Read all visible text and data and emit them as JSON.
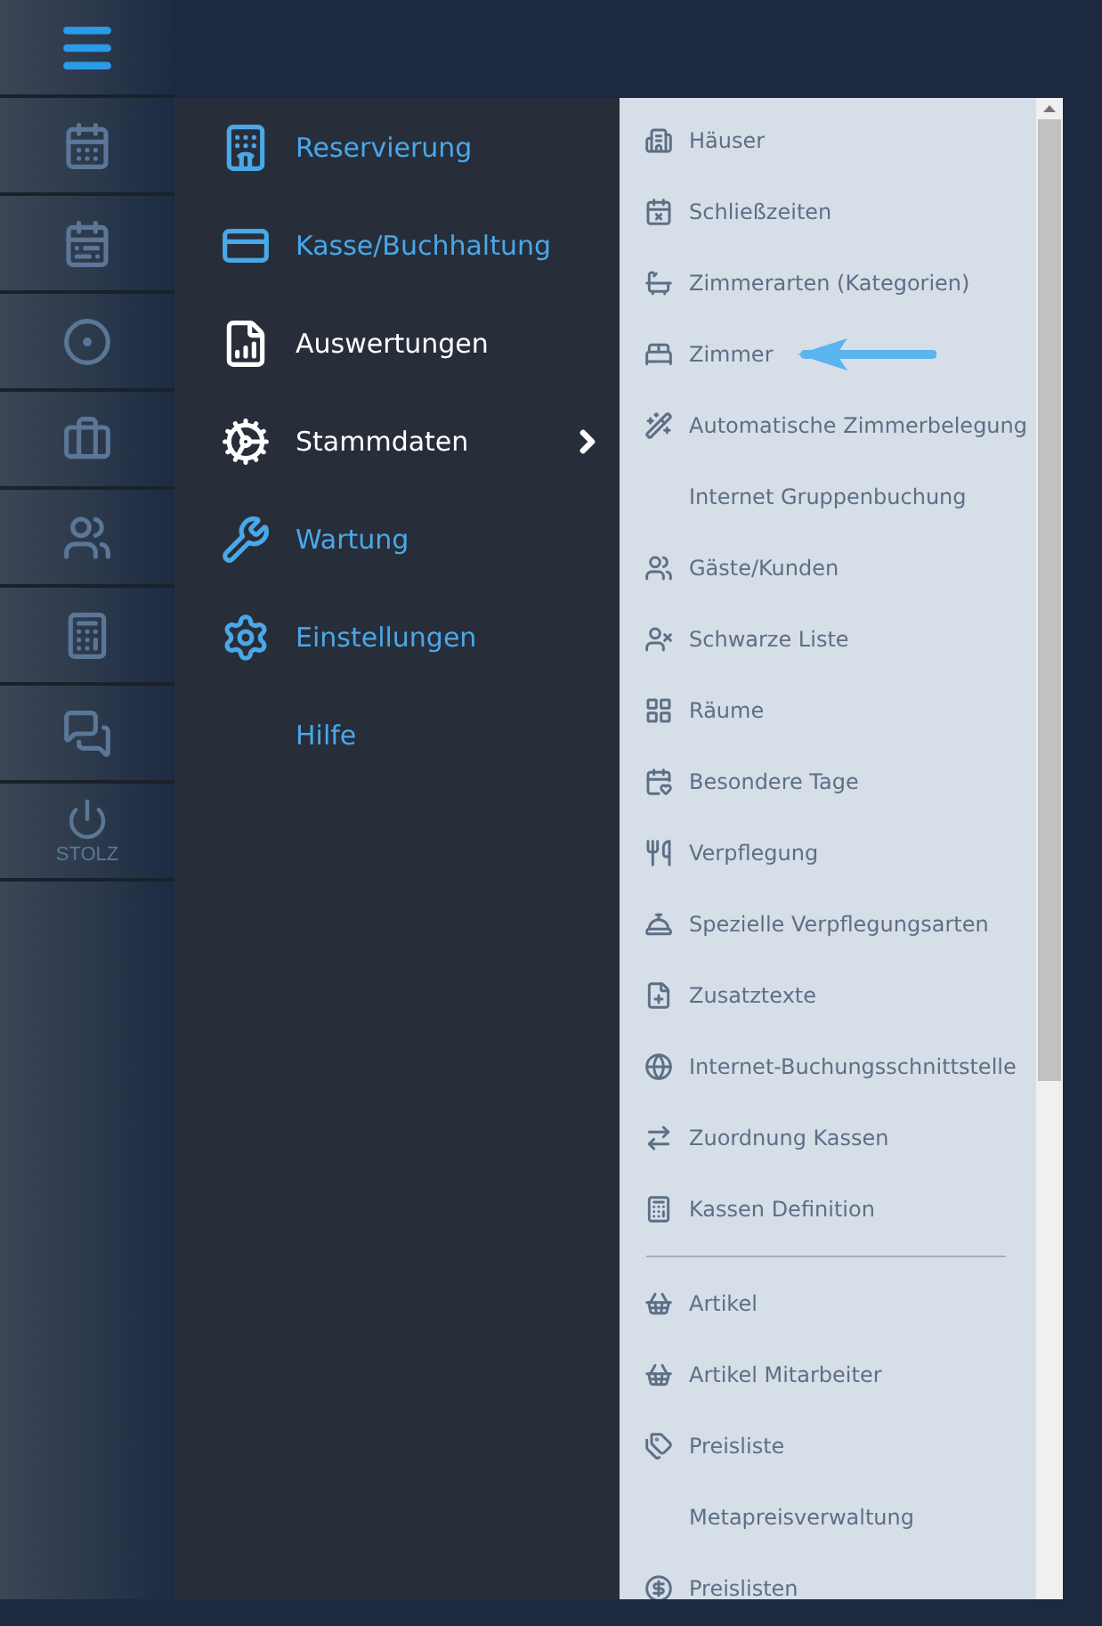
{
  "rail": {
    "items": [
      {
        "kind": "icon"
      },
      {
        "kind": "icon"
      },
      {
        "kind": "icon"
      },
      {
        "kind": "icon"
      },
      {
        "kind": "icon"
      },
      {
        "kind": "icon"
      },
      {
        "kind": "icon"
      },
      {
        "kind": "labeled",
        "label": "STOLZ"
      }
    ]
  },
  "menu": {
    "items": [
      {
        "label": "Reservierung",
        "highlighted": false,
        "expanded": false
      },
      {
        "label": "Kasse/Buchhaltung",
        "highlighted": false,
        "expanded": false
      },
      {
        "label": "Auswertungen",
        "highlighted": true,
        "expanded": false
      },
      {
        "label": "Stammdaten",
        "highlighted": true,
        "expanded": true
      },
      {
        "label": "Wartung",
        "highlighted": false,
        "expanded": false
      },
      {
        "label": "Einstellungen",
        "highlighted": false,
        "expanded": false
      },
      {
        "label": "Hilfe",
        "highlighted": false,
        "expanded": false
      }
    ]
  },
  "submenu": {
    "items": [
      {
        "kind": "link",
        "label": "Häuser"
      },
      {
        "kind": "link",
        "label": "Schließzeiten"
      },
      {
        "kind": "link",
        "label": "Zimmerarten (Kategorien)"
      },
      {
        "kind": "link",
        "label": "Zimmer"
      },
      {
        "kind": "link",
        "label": "Automatische Zimmerbelegung"
      },
      {
        "kind": "link",
        "label": "Internet Gruppenbuchung"
      },
      {
        "kind": "link",
        "label": "Gäste/Kunden"
      },
      {
        "kind": "link",
        "label": "Schwarze Liste"
      },
      {
        "kind": "link",
        "label": "Räume"
      },
      {
        "kind": "link",
        "label": "Besondere Tage"
      },
      {
        "kind": "link",
        "label": "Verpflegung"
      },
      {
        "kind": "link",
        "label": "Spezielle Verpflegungsarten"
      },
      {
        "kind": "link",
        "label": "Zusatztexte"
      },
      {
        "kind": "link",
        "label": "Internet-Buchungsschnittstelle"
      },
      {
        "kind": "link",
        "label": "Zuordnung Kassen"
      },
      {
        "kind": "link",
        "label": "Kassen Definition"
      },
      {
        "kind": "divider"
      },
      {
        "kind": "link",
        "label": "Artikel"
      },
      {
        "kind": "link",
        "label": "Artikel Mitarbeiter"
      },
      {
        "kind": "link",
        "label": "Preisliste"
      },
      {
        "kind": "link",
        "label": "Metapreisverwaltung"
      },
      {
        "kind": "link",
        "label": "Preislisten"
      }
    ]
  }
}
